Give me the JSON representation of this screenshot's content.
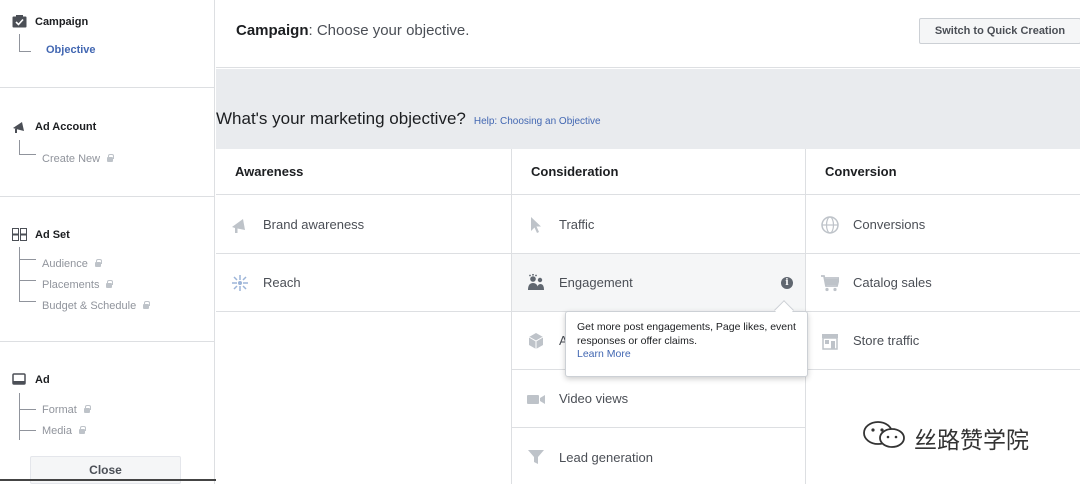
{
  "sidebar": {
    "campaign": {
      "title": "Campaign",
      "items": [
        {
          "label": "Objective"
        }
      ]
    },
    "ad_account": {
      "title": "Ad Account",
      "items": [
        {
          "label": "Create New"
        }
      ]
    },
    "ad_set": {
      "title": "Ad Set",
      "items": [
        {
          "label": "Audience"
        },
        {
          "label": "Placements"
        },
        {
          "label": "Budget & Schedule"
        }
      ]
    },
    "ad": {
      "title": "Ad",
      "items": [
        {
          "label": "Format"
        },
        {
          "label": "Media"
        }
      ]
    },
    "close_label": "Close"
  },
  "header": {
    "title_bold": "Campaign",
    "title_rest": ": Choose your objective.",
    "quick_creation_label": "Switch to Quick Creation"
  },
  "main": {
    "question": "What's your marketing objective?",
    "help_link": "Help: Choosing an Objective",
    "columns": [
      {
        "title": "Awareness",
        "items": [
          {
            "label": "Brand awareness",
            "icon": "megaphone-icon"
          },
          {
            "label": "Reach",
            "icon": "reach-icon"
          }
        ]
      },
      {
        "title": "Consideration",
        "items": [
          {
            "label": "Traffic",
            "icon": "cursor-icon"
          },
          {
            "label": "Engagement",
            "icon": "people-icon"
          },
          {
            "label": "A",
            "icon": "box-icon"
          },
          {
            "label": "Video views",
            "icon": "video-camera-icon"
          },
          {
            "label": "Lead generation",
            "icon": "funnel-icon"
          }
        ]
      },
      {
        "title": "Conversion",
        "items": [
          {
            "label": "Conversions",
            "icon": "globe-icon"
          },
          {
            "label": "Catalog sales",
            "icon": "cart-icon"
          },
          {
            "label": "Store traffic",
            "icon": "store-icon"
          }
        ]
      }
    ],
    "tooltip": {
      "text": "Get more post engagements, Page likes, event responses or offer claims.",
      "link": "Learn More"
    }
  },
  "watermark": {
    "text": "丝路赞学院"
  },
  "colors": {
    "link": "#4267b2",
    "border": "#dddfe2",
    "background": "#e9ebee",
    "muted": "#90949c"
  }
}
